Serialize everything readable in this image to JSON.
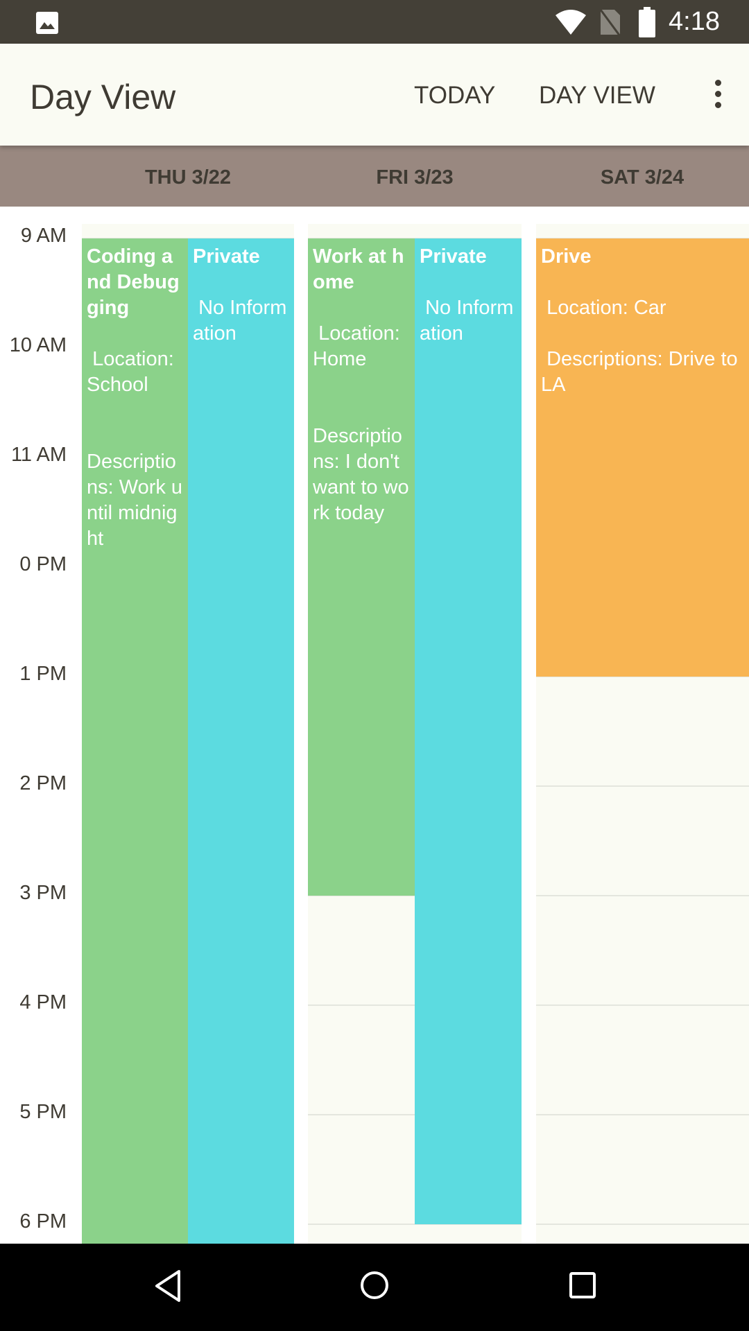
{
  "status_bar": {
    "time": "4:18",
    "icons": [
      "image-icon",
      "wifi-icon",
      "no-sim-icon",
      "battery-icon"
    ]
  },
  "app_bar": {
    "title": "Day View",
    "today_label": "TODAY",
    "day_view_label": "DAY VIEW",
    "more_icon": "more-vert-icon"
  },
  "days": [
    "THU 3/22",
    "FRI 3/23",
    "SAT 3/24"
  ],
  "hours": [
    "9 AM",
    "10 AM",
    "11 AM",
    "0 PM",
    "1 PM",
    "2 PM",
    "3 PM",
    "4 PM",
    "5 PM",
    "6 PM"
  ],
  "colors": {
    "green": "#8BD28A",
    "cyan": "#5CDBE0",
    "orange": "#F8B553",
    "header": "#998880"
  },
  "events": [
    {
      "day": 0,
      "lane": 0,
      "lanes": 2,
      "start": 9,
      "end": 19,
      "color": "#8BD28A",
      "title": "Coding and Debugging",
      "body": "\n\n Location: School\n\n\nDescriptions: Work until midnight"
    },
    {
      "day": 0,
      "lane": 1,
      "lanes": 2,
      "start": 9,
      "end": 19,
      "color": "#5CDBE0",
      "title": "Private",
      "body": "\n\n No Information"
    },
    {
      "day": 1,
      "lane": 0,
      "lanes": 2,
      "start": 9,
      "end": 15,
      "color": "#8BD28A",
      "title": "Work at home",
      "body": "\n\n Location: Home\n\n\nDescriptions: I don't want to work today"
    },
    {
      "day": 1,
      "lane": 1,
      "lanes": 2,
      "start": 9,
      "end": 18,
      "color": "#5CDBE0",
      "title": "Private",
      "body": "\n\n No Information"
    },
    {
      "day": 2,
      "lane": 0,
      "lanes": 1,
      "start": 9,
      "end": 13,
      "color": "#F8B553",
      "title": "Drive",
      "body": "\n\n Location: Car\n\n Descriptions: Drive to LA"
    }
  ],
  "nav_bar": {
    "icons": [
      "back-icon",
      "home-icon",
      "recents-icon"
    ]
  }
}
